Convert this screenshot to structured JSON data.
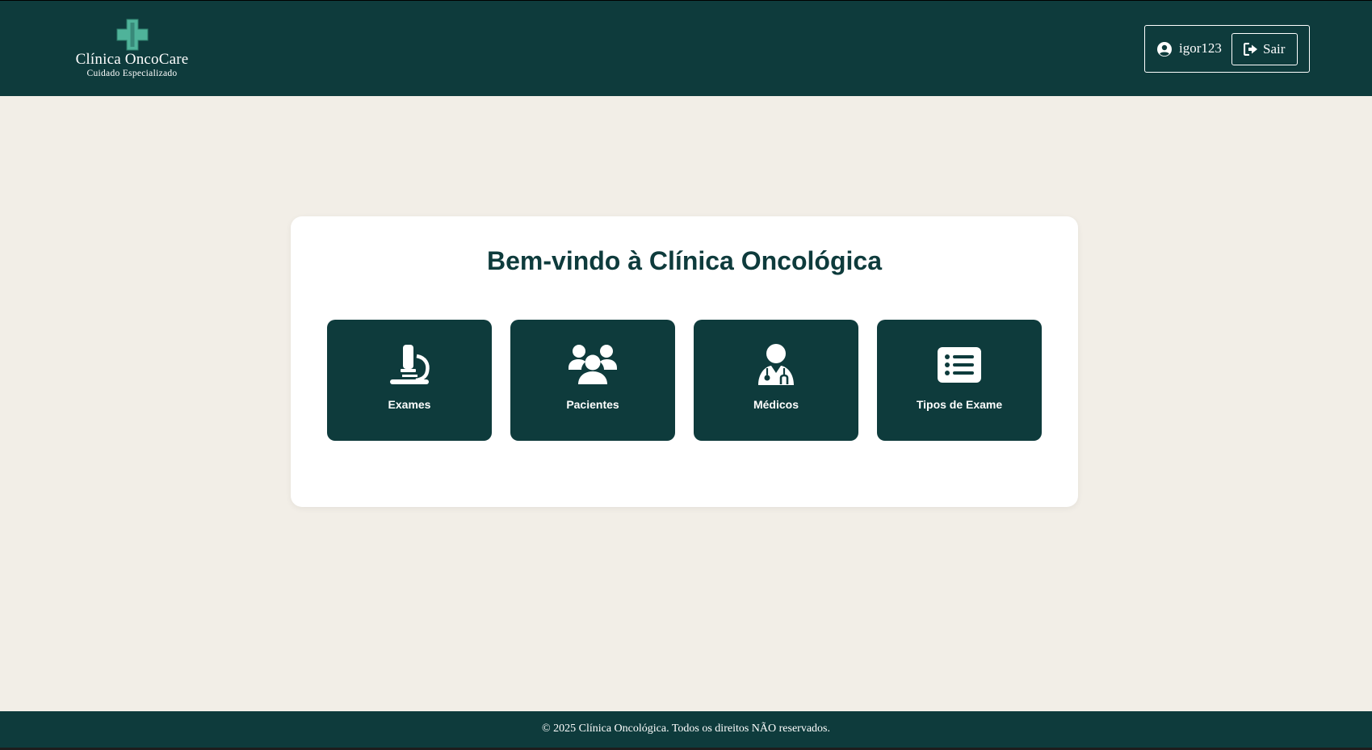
{
  "header": {
    "logo_title": "Clínica OncoCare",
    "logo_subtitle": "Cuidado Especializado",
    "logo_icon": "medical-cross-icon",
    "username": "igor123",
    "logout_label": "Sair"
  },
  "main": {
    "title": "Bem-vindo à Clínica Oncológica",
    "tiles": [
      {
        "label": "Exames",
        "icon": "microscope-icon"
      },
      {
        "label": "Pacientes",
        "icon": "users-icon"
      },
      {
        "label": "Médicos",
        "icon": "user-doctor-icon"
      },
      {
        "label": "Tipos de Exame",
        "icon": "list-icon"
      }
    ]
  },
  "footer": {
    "text": "© 2025 Clínica Oncológica. Todos os direitos NÃO reservados."
  },
  "colors": {
    "primary": "#0e3b3c",
    "background": "#f2eee7",
    "card": "#ffffff",
    "logo_accent": "#4fb39a"
  }
}
